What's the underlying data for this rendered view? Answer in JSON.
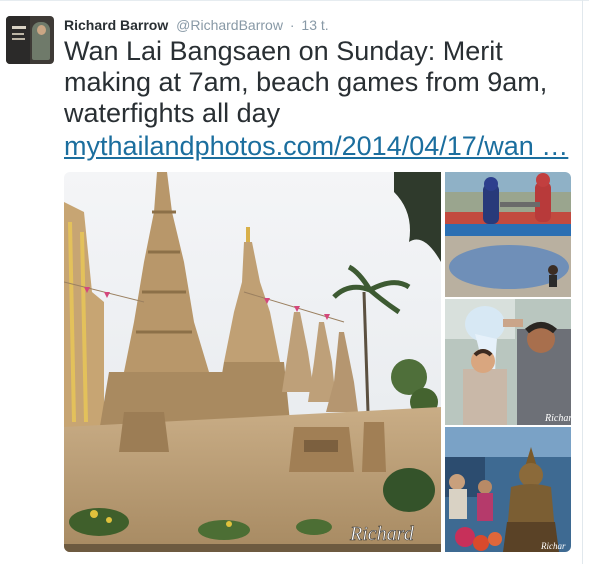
{
  "tweet": {
    "author_name": "Richard Barrow",
    "author_handle": "@RichardBarrow",
    "separator": "·",
    "timestamp": "13 t.",
    "text": "Wan Lai Bangsaen on Sunday: Merit making at 7am, beach games from 9am, waterfights all day",
    "link_text": "mythailandphotos.com/2014/04/17/wan …",
    "media": {
      "main_watermark": "Richard",
      "side_watermark_1": "Richard",
      "side_watermark_2": "Richar"
    }
  }
}
